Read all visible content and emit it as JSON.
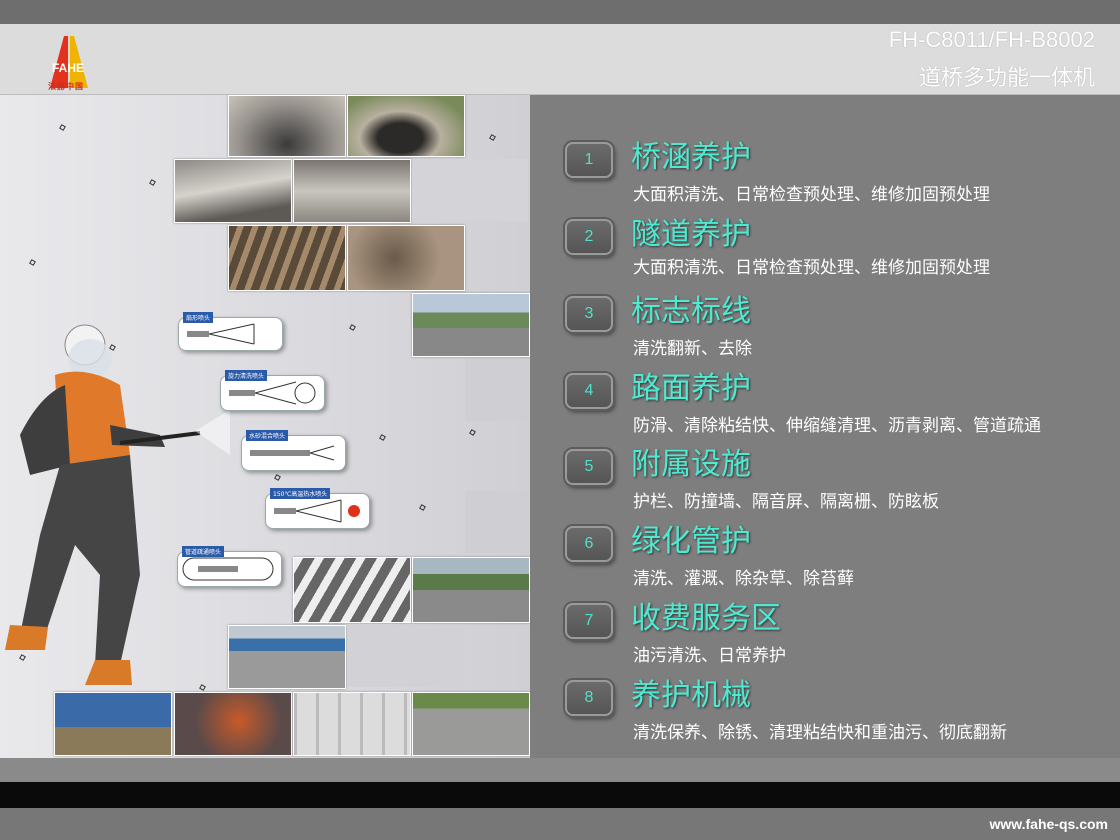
{
  "header": {
    "logo_text": "FAHE",
    "logo_subtext": "法赫中国",
    "model": "FH-C8011/FH-B8002",
    "product_name": "道桥多功能一体机"
  },
  "nozzles": [
    {
      "label": "扇形喷头"
    },
    {
      "label": "旋力清洗喷头"
    },
    {
      "label": "水砂混合喷头"
    },
    {
      "label": "150℃高温热水喷头"
    },
    {
      "label": "管道疏通喷头"
    }
  ],
  "items": [
    {
      "num": "1",
      "title": "桥涵养护",
      "desc": "大面积清洗、日常检查预处理、维修加固预处理"
    },
    {
      "num": "2",
      "title": "隧道养护",
      "desc": "大面积清洗、日常检查预处理、维修加固预处理"
    },
    {
      "num": "3",
      "title": "标志标线",
      "desc": "清洗翻新、去除"
    },
    {
      "num": "4",
      "title": "路面养护",
      "desc": "防滑、清除粘结快、伸缩缝清理、沥青剥离、管道疏通"
    },
    {
      "num": "5",
      "title": "附属设施",
      "desc": "护栏、防撞墙、隔音屏、隔离栅、防眩板"
    },
    {
      "num": "6",
      "title": "绿化管护",
      "desc": "清洗、灌溉、除杂草、除苔藓"
    },
    {
      "num": "7",
      "title": "收费服务区",
      "desc": "油污清洗、日常养护"
    },
    {
      "num": "8",
      "title": "养护机械",
      "desc": "清洗保养、除锈、清理粘结快和重油污、彻底翻新"
    }
  ],
  "footer": {
    "url": "www.fahe-qs.com"
  },
  "colors": {
    "accent": "#4fe8d0",
    "header_bg": "#dcdcdc",
    "panel_bg": "#7e7e7e"
  }
}
